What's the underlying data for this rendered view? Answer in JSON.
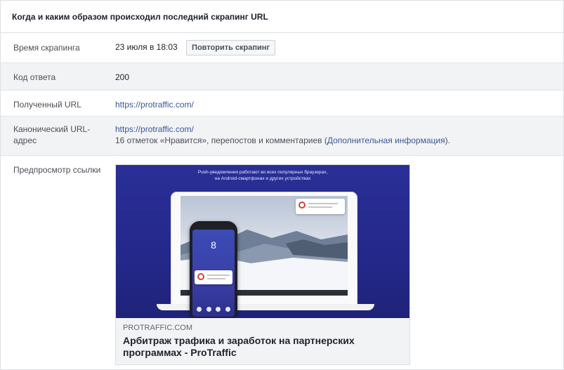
{
  "header": {
    "title": "Когда и каким образом происходил последний скрапинг URL"
  },
  "rows": {
    "scrape_time": {
      "label": "Время скрапинга",
      "value": "23 июля в 18:03",
      "button": "Повторить скрапинг"
    },
    "response_code": {
      "label": "Код ответа",
      "value": "200"
    },
    "fetched_url": {
      "label": "Полученный URL",
      "value": "https://protraffic.com/"
    },
    "canonical_url": {
      "label": "Канонический URL-адрес",
      "value": "https://protraffic.com/",
      "stats_text": "16 отметок «Нравится», перепостов и комментариев (",
      "more_link": "Дополнительная информация",
      "stats_end": ")."
    },
    "link_preview": {
      "label": "Предпросмотр ссылки",
      "image_caption_line1": "Push-уведомления работают во всех популярных браузерах,",
      "image_caption_line2": "на Android-смартфонах и других устройствах",
      "phone_digit": "8",
      "domain": "PROTRAFFIC.COM",
      "title": "Арбитраж трафика и заработок на партнерских программах - ProTraffic"
    }
  },
  "colors": {
    "link": "#385898",
    "alt_row": "#f2f3f5",
    "preview_bg": "#2a2f97"
  }
}
